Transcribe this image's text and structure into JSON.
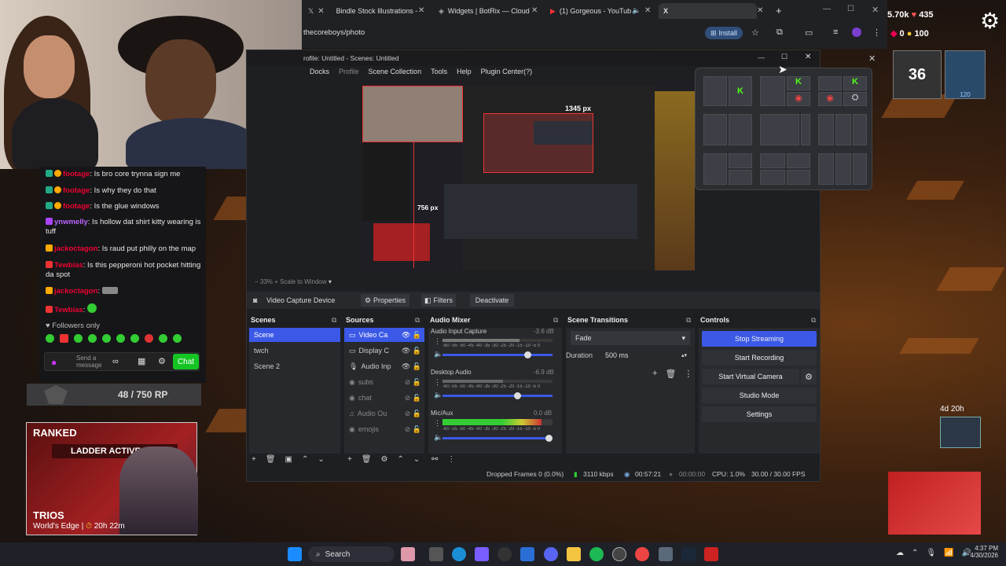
{
  "browser": {
    "tabs": [
      {
        "label": "Bindle Stock Illustrations -"
      },
      {
        "label": "Widgets | BotRix — Cloud"
      },
      {
        "label": "(1) Gorgeous - YouTub"
      },
      {
        "label": "X"
      }
    ],
    "address": "thecoreboys/photo",
    "install_label": "Install"
  },
  "stream_stats": {
    "viewers": "5.70k",
    "likes": "435",
    "coins": "0",
    "points": "100"
  },
  "chat": {
    "messages": [
      {
        "user": "footage",
        "text": ": Is bro core trynna sign me"
      },
      {
        "user": "footage",
        "text": ": Is why they do that"
      },
      {
        "user": "footage",
        "text": ": Is the glue windows"
      },
      {
        "user": "ynwmelly",
        "text": ": Is hollow dat shirt kitty wearing is tuff"
      },
      {
        "user": "jackoctagon",
        "text": ": Is raud put philly on the map"
      },
      {
        "user": "Tewbias",
        "text": ": Is this pepperoni hot pocket hitting da spot"
      },
      {
        "user": "jackoctagon",
        "text": ":"
      },
      {
        "user": "Tewbias",
        "text": ":"
      }
    ],
    "followers_only": "Followers only",
    "send_placeholder": "Send a message",
    "chat_button": "Chat"
  },
  "game": {
    "rp": "48 / 750 RP",
    "ranked": "RANKED",
    "ladder": "LADDER ACTIVE",
    "mode": "TRIOS",
    "map": "World's Edge |",
    "time": "20h 22m",
    "level": "36",
    "countdown": "4d 20h",
    "rank_level": "120"
  },
  "obs": {
    "title": "rofile: Untitled - Scenes: Untitled",
    "menu": [
      "Docks",
      "Profile",
      "Scene Collection",
      "Tools",
      "Help",
      "Plugin Center(?)"
    ],
    "preview_size": "1345 px",
    "preview_size2": "756 px",
    "zoom": "33%",
    "scale": "Scale to Window",
    "source_bar": {
      "source": "Video Capture Device",
      "properties": "Properties",
      "filters": "Filters",
      "deactivate": "Deactivate"
    },
    "scenes": {
      "title": "Scenes",
      "items": [
        "Scene",
        "twch",
        "Scene 2"
      ]
    },
    "sources": {
      "title": "Sources",
      "items": [
        "Video Ca",
        "Display C",
        "Audio Inp",
        "subs",
        "chat",
        "Audio Ou",
        "emojis"
      ]
    },
    "audio_mixer": {
      "title": "Audio Mixer",
      "channels": [
        {
          "name": "Audio Input Capture",
          "db": "-3.6 dB",
          "level": 0.7
        },
        {
          "name": "Desktop Audio",
          "db": "-6.9 dB",
          "level": 0.55
        },
        {
          "name": "Mic/Aux",
          "db": "0.0 dB",
          "level": 0.9
        }
      ],
      "scale": "-60 -55 -50 -45 -40 -35 -30 -25 -20 -15 -10 -5 0"
    },
    "transitions": {
      "title": "Scene Transitions",
      "type": "Fade",
      "duration_label": "Duration",
      "duration": "500 ms"
    },
    "controls": {
      "title": "Controls",
      "stop_streaming": "Stop Streaming",
      "start_recording": "Start Recording",
      "start_virtual_camera": "Start Virtual Camera",
      "studio_mode": "Studio Mode",
      "settings": "Settings"
    },
    "status": {
      "dropped": "Dropped Frames 0 (0.0%)",
      "bitrate": "3110 kbps",
      "live": "00:57:21",
      "rec": "00:00:00",
      "cpu": "CPU: 1.0%",
      "fps": "30.00 / 30.00 FPS"
    }
  },
  "taskbar": {
    "search": "Search",
    "time": "4:37 PM",
    "date": "4/30/2026"
  },
  "colors": {
    "accent": "#3b59e6",
    "obs_bg": "#1e1f22",
    "chat_button": "#15c524"
  }
}
